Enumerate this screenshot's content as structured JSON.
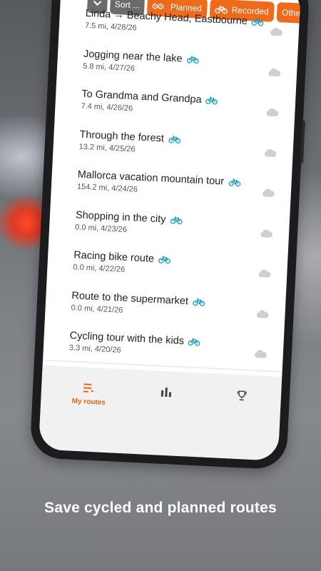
{
  "tagline": "Save cycled and planned routes",
  "filters": {
    "sort_label": "Sort ...",
    "planned_label": "Planned",
    "recorded_label": "Recorded",
    "other_label": "Other"
  },
  "routes": [
    {
      "title": "Linda → Beachy Head, Eastbourne",
      "meta": "7.5 mi, 4/28/26"
    },
    {
      "title": "Jogging near the lake",
      "meta": "5.8 mi, 4/27/26"
    },
    {
      "title": "To Grandma and Grandpa",
      "meta": "7.4 mi, 4/26/26"
    },
    {
      "title": "Through the forest",
      "meta": "13.2 mi, 4/25/26"
    },
    {
      "title": "Mallorca vacation mountain tour",
      "meta": "154.2 mi, 4/24/26"
    },
    {
      "title": "Shopping in the city",
      "meta": "0.0 mi, 4/23/26"
    },
    {
      "title": "Racing bike route",
      "meta": "0.0 mi, 4/22/26"
    },
    {
      "title": "Route to the supermarket",
      "meta": "0.0 mi, 4/21/26"
    },
    {
      "title": "Cycling tour with the kids",
      "meta": "3.3 mi, 4/20/26"
    }
  ],
  "bottom_nav": {
    "my_routes_label": "My routes",
    "stats_icon": "bar-chart-icon",
    "trophy_icon": "trophy-icon"
  },
  "colors": {
    "accent": "#ef6a1a",
    "bike_icon": "#1c9fbf",
    "cloud_icon": "#cfcfcf"
  }
}
